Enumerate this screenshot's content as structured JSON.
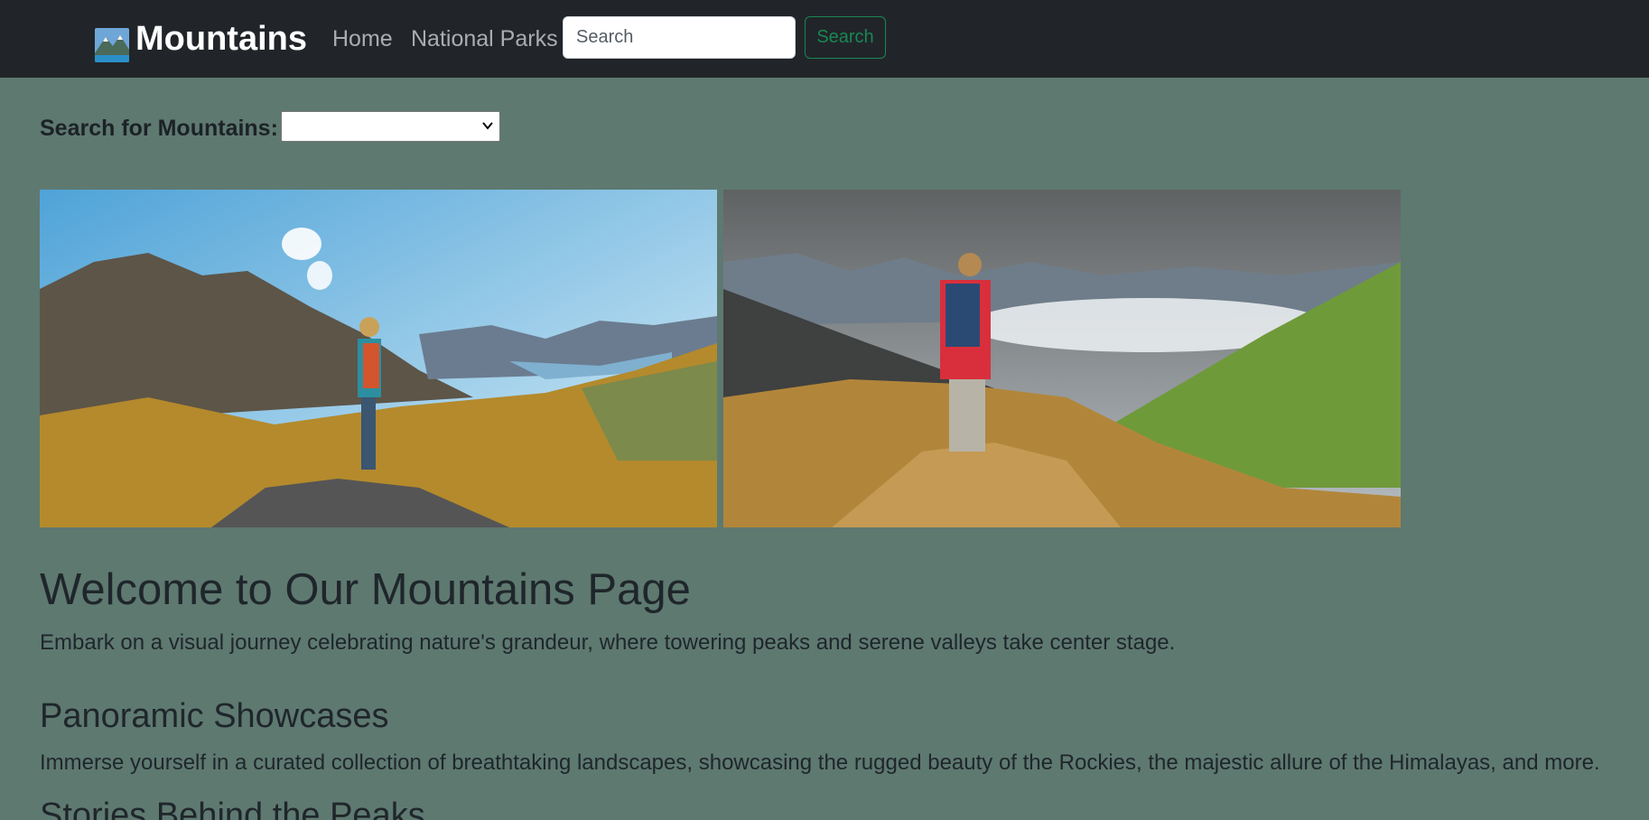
{
  "navbar": {
    "brand": "Mountains",
    "links": [
      "Home",
      "National Parks"
    ],
    "search_placeholder": "Search",
    "search_button": "Search"
  },
  "filter": {
    "label": "Search for Mountains:",
    "selected": ""
  },
  "content": {
    "title": "Welcome to Our Mountains Page",
    "intro": "Embark on a visual journey celebrating nature's grandeur, where towering peaks and serene valleys take center stage.",
    "sections": [
      {
        "heading": "Panoramic Showcases",
        "text": "Immerse yourself in a curated collection of breathtaking landscapes, showcasing the rugged beauty of the Rockies, the majestic allure of the Himalayas, and more."
      },
      {
        "heading": "Stories Behind the Peaks"
      }
    ]
  },
  "colors": {
    "navbar_bg": "#212529",
    "page_bg": "#5e7970",
    "accent": "#198754"
  }
}
